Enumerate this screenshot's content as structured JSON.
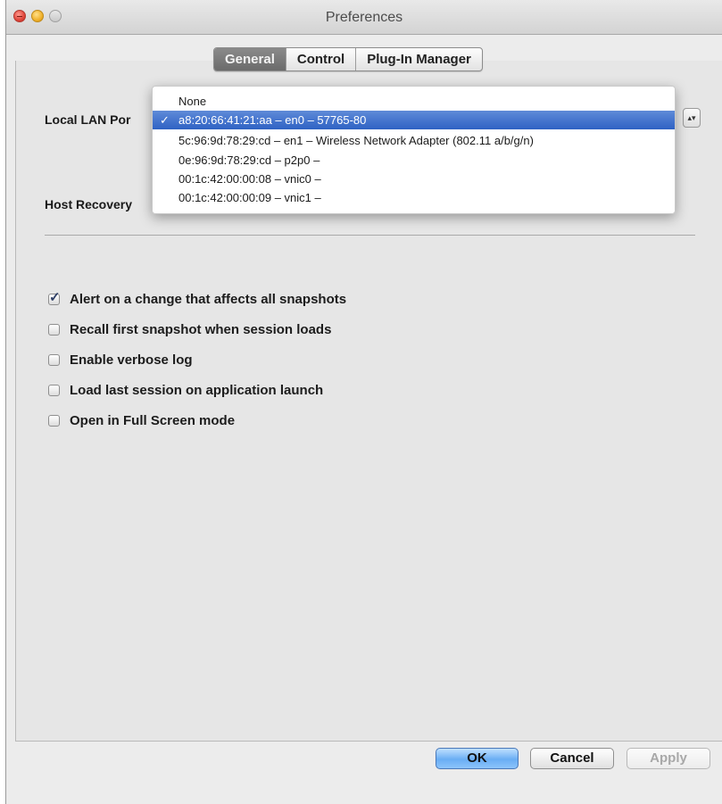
{
  "window": {
    "title": "Preferences"
  },
  "tabs": [
    {
      "label": "General",
      "active": true
    },
    {
      "label": "Control",
      "active": false
    },
    {
      "label": "Plug-In Manager",
      "active": false
    }
  ],
  "general": {
    "local_lan_label": "Local LAN Por",
    "host_recovery_label": "Host Recovery",
    "dropdown": {
      "options": [
        {
          "label": "None",
          "selected": false
        },
        {
          "label": "a8:20:66:41:21:aa – en0 – 57765-80",
          "selected": true,
          "checkmark": "✓"
        },
        {
          "label": "5c:96:9d:78:29:cd – en1 – Wireless Network Adapter (802.11 a/b/g/n)",
          "selected": false
        },
        {
          "label": "0e:96:9d:78:29:cd – p2p0 –",
          "selected": false
        },
        {
          "label": "00:1c:42:00:00:08 – vnic0 –",
          "selected": false
        },
        {
          "label": "00:1c:42:00:00:09 – vnic1 –",
          "selected": false
        }
      ]
    },
    "checkboxes": [
      {
        "label": "Alert on a change that affects all snapshots",
        "checked": true
      },
      {
        "label": "Recall first snapshot when session loads",
        "checked": false
      },
      {
        "label": "Enable verbose log",
        "checked": false
      },
      {
        "label": "Load last session on application launch",
        "checked": false
      },
      {
        "label": "Open in Full Screen mode",
        "checked": false
      }
    ]
  },
  "buttons": {
    "ok": "OK",
    "cancel": "Cancel",
    "apply": "Apply"
  },
  "icons": {
    "select_arrows": "select-arrows-icon",
    "checkmark": "checkmark-icon"
  },
  "colors": {
    "selection": "#2f62c4",
    "default_button": "#6aaef4"
  }
}
